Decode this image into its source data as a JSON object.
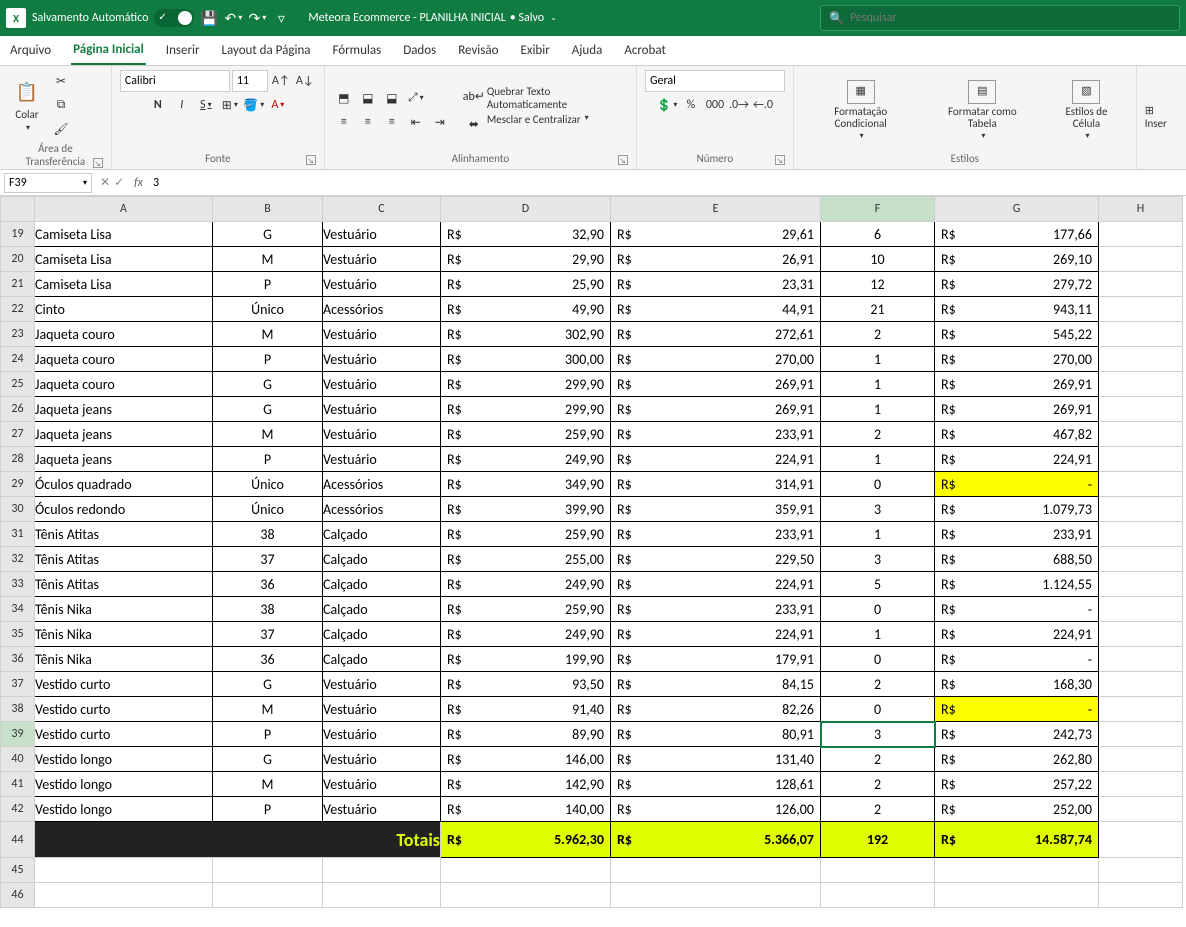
{
  "titlebar": {
    "app_logo": "X",
    "autosave_label": "Salvamento Automático",
    "file_title": "Meteora Ecommerce - PLANILHA INICIAL",
    "saved_status": "• Salvo",
    "search_placeholder": "Pesquisar"
  },
  "tabs": [
    {
      "label": "Arquivo"
    },
    {
      "label": "Página Inicial"
    },
    {
      "label": "Inserir"
    },
    {
      "label": "Layout da Página"
    },
    {
      "label": "Fórmulas"
    },
    {
      "label": "Dados"
    },
    {
      "label": "Revisão"
    },
    {
      "label": "Exibir"
    },
    {
      "label": "Ajuda"
    },
    {
      "label": "Acrobat"
    }
  ],
  "ribbon": {
    "clipboard": {
      "label": "Área de Transferência",
      "paste": "Colar"
    },
    "font": {
      "label": "Fonte",
      "name": "Calibri",
      "size": "11"
    },
    "alignment": {
      "label": "Alinhamento",
      "wrap": "Quebrar Texto Automaticamente",
      "merge": "Mesclar e Centralizar"
    },
    "number": {
      "label": "Número",
      "format": "Geral"
    },
    "styles": {
      "label": "Estilos",
      "cond": "Formatação Condicional",
      "table": "Formatar como Tabela",
      "cell": "Estilos de Célula"
    },
    "insert": {
      "label": "Inser"
    }
  },
  "namebox": "F39",
  "formula": "3",
  "columns": [
    "A",
    "B",
    "C",
    "D",
    "E",
    "F",
    "G",
    "H"
  ],
  "colWidths": {
    "A": "col-A",
    "B": "col-B",
    "C": "col-C",
    "D": "col-D",
    "E": "col-E",
    "F": "col-F",
    "G": "col-G",
    "H": "col-H"
  },
  "rowStart": 19,
  "rows": [
    {
      "n": 19,
      "a": "Camiseta Lisa",
      "b": "G",
      "c": "Vestuário",
      "d": "32,90",
      "e": "29,61",
      "f": "6",
      "g": "177,66"
    },
    {
      "n": 20,
      "a": "Camiseta Lisa",
      "b": "M",
      "c": "Vestuário",
      "d": "29,90",
      "e": "26,91",
      "f": "10",
      "g": "269,10"
    },
    {
      "n": 21,
      "a": "Camiseta Lisa",
      "b": "P",
      "c": "Vestuário",
      "d": "25,90",
      "e": "23,31",
      "f": "12",
      "g": "279,72"
    },
    {
      "n": 22,
      "a": "Cinto",
      "b": "Único",
      "c": "Acessórios",
      "d": "49,90",
      "e": "44,91",
      "f": "21",
      "g": "943,11"
    },
    {
      "n": 23,
      "a": "Jaqueta couro",
      "b": "M",
      "c": "Vestuário",
      "d": "302,90",
      "e": "272,61",
      "f": "2",
      "g": "545,22"
    },
    {
      "n": 24,
      "a": "Jaqueta couro",
      "b": "P",
      "c": "Vestuário",
      "d": "300,00",
      "e": "270,00",
      "f": "1",
      "g": "270,00"
    },
    {
      "n": 25,
      "a": "Jaqueta couro",
      "b": "G",
      "c": "Vestuário",
      "d": "299,90",
      "e": "269,91",
      "f": "1",
      "g": "269,91"
    },
    {
      "n": 26,
      "a": "Jaqueta jeans",
      "b": "G",
      "c": "Vestuário",
      "d": "299,90",
      "e": "269,91",
      "f": "1",
      "g": "269,91"
    },
    {
      "n": 27,
      "a": "Jaqueta jeans",
      "b": "M",
      "c": "Vestuário",
      "d": "259,90",
      "e": "233,91",
      "f": "2",
      "g": "467,82"
    },
    {
      "n": 28,
      "a": "Jaqueta jeans",
      "b": "P",
      "c": "Vestuário",
      "d": "249,90",
      "e": "224,91",
      "f": "1",
      "g": "224,91"
    },
    {
      "n": 29,
      "a": "Óculos quadrado",
      "b": "Único",
      "c": "Acessórios",
      "d": "349,90",
      "e": "314,91",
      "f": "0",
      "g": "-",
      "gyellow": true
    },
    {
      "n": 30,
      "a": "Óculos redondo",
      "b": "Único",
      "c": "Acessórios",
      "d": "399,90",
      "e": "359,91",
      "f": "3",
      "g": "1.079,73"
    },
    {
      "n": 31,
      "a": "Tênis Atitas",
      "b": "38",
      "c": "Calçado",
      "d": "259,90",
      "e": "233,91",
      "f": "1",
      "g": "233,91"
    },
    {
      "n": 32,
      "a": "Tênis Atitas",
      "b": "37",
      "c": "Calçado",
      "d": "255,00",
      "e": "229,50",
      "f": "3",
      "g": "688,50"
    },
    {
      "n": 33,
      "a": "Tênis Atitas",
      "b": "36",
      "c": "Calçado",
      "d": "249,90",
      "e": "224,91",
      "f": "5",
      "g": "1.124,55"
    },
    {
      "n": 34,
      "a": "Tênis Nika",
      "b": "38",
      "c": "Calçado",
      "d": "259,90",
      "e": "233,91",
      "f": "0",
      "g": "-"
    },
    {
      "n": 35,
      "a": "Tênis Nika",
      "b": "37",
      "c": "Calçado",
      "d": "249,90",
      "e": "224,91",
      "f": "1",
      "g": "224,91"
    },
    {
      "n": 36,
      "a": "Tênis Nika",
      "b": "36",
      "c": "Calçado",
      "d": "199,90",
      "e": "179,91",
      "f": "0",
      "g": "-"
    },
    {
      "n": 37,
      "a": "Vestido curto",
      "b": "G",
      "c": "Vestuário",
      "d": "93,50",
      "e": "84,15",
      "f": "2",
      "g": "168,30"
    },
    {
      "n": 38,
      "a": "Vestido curto",
      "b": "M",
      "c": "Vestuário",
      "d": "91,40",
      "e": "82,26",
      "f": "0",
      "g": "-",
      "gyellow": true
    },
    {
      "n": 39,
      "a": "Vestido curto",
      "b": "P",
      "c": "Vestuário",
      "d": "89,90",
      "e": "80,91",
      "f": "3",
      "g": "242,73",
      "active": true
    },
    {
      "n": 40,
      "a": "Vestido longo",
      "b": "G",
      "c": "Vestuário",
      "d": "146,00",
      "e": "131,40",
      "f": "2",
      "g": "262,80"
    },
    {
      "n": 41,
      "a": "Vestido longo",
      "b": "M",
      "c": "Vestuário",
      "d": "142,90",
      "e": "128,61",
      "f": "2",
      "g": "257,22"
    },
    {
      "n": 42,
      "a": "Vestido longo",
      "b": "P",
      "c": "Vestuário",
      "d": "140,00",
      "e": "126,00",
      "f": "2",
      "g": "252,00"
    }
  ],
  "totals": {
    "n": 44,
    "label": "Totais",
    "d": "5.962,30",
    "e": "5.366,07",
    "f": "192",
    "g": "14.587,74"
  },
  "emptyRows": [
    45,
    46
  ],
  "currency_symbol": "R$"
}
